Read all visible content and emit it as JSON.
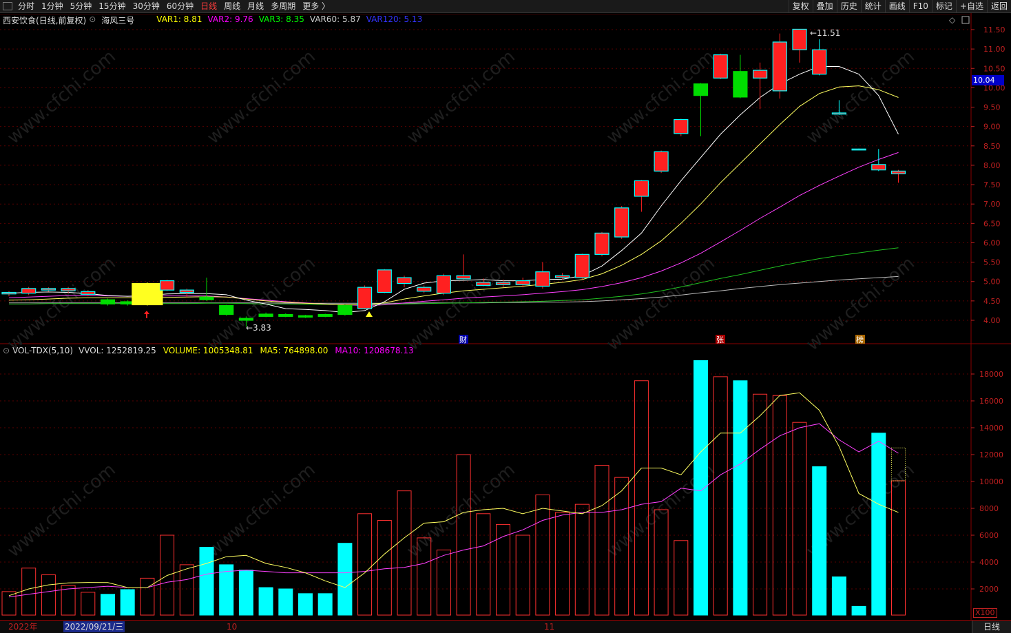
{
  "toolbar": {
    "left_items": [
      {
        "label": "分时",
        "active": false
      },
      {
        "label": "1分钟",
        "active": false
      },
      {
        "label": "5分钟",
        "active": false
      },
      {
        "label": "15分钟",
        "active": false
      },
      {
        "label": "30分钟",
        "active": false
      },
      {
        "label": "60分钟",
        "active": false
      },
      {
        "label": "日线",
        "active": true
      },
      {
        "label": "周线",
        "active": false
      },
      {
        "label": "月线",
        "active": false
      },
      {
        "label": "多周期",
        "active": false
      },
      {
        "label": "更多 〉",
        "active": false
      }
    ],
    "right_items": [
      "复权",
      "叠加",
      "历史",
      "统计",
      "画线",
      "F10",
      "标记",
      "+自选",
      "返回"
    ]
  },
  "price_panel": {
    "stock_name": "西安饮食",
    "mode": "(日线,前复权)",
    "formula": "海风三号",
    "indicators": [
      {
        "text": "VAR1: 8.81",
        "color": "#ffff00"
      },
      {
        "text": "VAR2: 9.76",
        "color": "#ff00ff"
      },
      {
        "text": "VAR3: 8.35",
        "color": "#00ff00"
      },
      {
        "text": "VAR60: 5.87",
        "color": "#cccccc"
      },
      {
        "text": "VAR120: 5.13",
        "color": "#3333ff"
      }
    ],
    "y_ticks": [
      "11.50",
      "11.00",
      "10.50",
      "10.00",
      "9.50",
      "9.00",
      "8.50",
      "8.00",
      "7.50",
      "7.00",
      "6.50",
      "6.00",
      "5.50",
      "5.00",
      "4.50",
      "4.00"
    ],
    "current_price": "10.04",
    "high_label": "11.51",
    "low_label": "3.83",
    "event_markers": [
      "财",
      "张",
      "榜"
    ]
  },
  "volume_panel": {
    "title": "VOL-TDX(5,10)",
    "indicators": [
      {
        "text": "VVOL: 1252819.25",
        "color": "#dddddd"
      },
      {
        "text": "VOLUME: 1005348.81",
        "color": "#ffff00"
      },
      {
        "text": "MA5: 764898.00",
        "color": "#ffff00"
      },
      {
        "text": "MA10: 1208678.13",
        "color": "#ff00ff"
      }
    ],
    "y_ticks": [
      "18000",
      "16000",
      "14000",
      "12000",
      "10000",
      "8000",
      "6000",
      "4000",
      "2000"
    ],
    "unit": "X100"
  },
  "date_axis": {
    "labels": [
      "2022年",
      "2022/09/21/三",
      "10",
      "11"
    ],
    "period": "日线"
  },
  "colors": {
    "up": "#ff2020",
    "down": "#00ffff",
    "down_price": "#00dd00",
    "ma_white": "#ffffff",
    "ma_yellow": "#ffff60",
    "ma_magenta": "#ff40ff",
    "ma_green": "#20c020",
    "ma_gray": "#bbbbbb"
  },
  "chart_data": {
    "type": "candlestick",
    "candles": [
      {
        "o": 4.68,
        "c": 4.72,
        "h": 4.75,
        "l": 4.62
      },
      {
        "o": 4.7,
        "c": 4.82,
        "h": 4.86,
        "l": 4.65
      },
      {
        "o": 4.78,
        "c": 4.82,
        "h": 4.85,
        "l": 4.74
      },
      {
        "o": 4.76,
        "c": 4.82,
        "h": 4.86,
        "l": 4.7
      },
      {
        "o": 4.67,
        "c": 4.74,
        "h": 4.78,
        "l": 4.62
      },
      {
        "o": 4.53,
        "c": 4.42,
        "h": 4.56,
        "l": 4.38
      },
      {
        "o": 4.48,
        "c": 4.42,
        "h": 4.52,
        "l": 4.38
      },
      {
        "o": 4.4,
        "c": 4.95,
        "h": 4.98,
        "l": 4.38
      },
      {
        "o": 4.78,
        "c": 5.02,
        "h": 5.05,
        "l": 4.75
      },
      {
        "o": 4.72,
        "c": 4.78,
        "h": 4.82,
        "l": 4.6
      },
      {
        "o": 4.6,
        "c": 4.53,
        "h": 5.1,
        "l": 4.5
      },
      {
        "o": 4.38,
        "c": 4.15,
        "h": 4.4,
        "l": 4.12
      },
      {
        "o": 4.05,
        "c": 4.0,
        "h": 4.1,
        "l": 3.83
      },
      {
        "o": 4.16,
        "c": 4.1,
        "h": 4.2,
        "l": 4.08
      },
      {
        "o": 4.15,
        "c": 4.1,
        "h": 4.18,
        "l": 4.08
      },
      {
        "o": 4.12,
        "c": 4.08,
        "h": 4.14,
        "l": 4.06
      },
      {
        "o": 4.15,
        "c": 4.1,
        "h": 4.17,
        "l": 4.08
      },
      {
        "o": 4.38,
        "c": 4.15,
        "h": 4.4,
        "l": 4.12
      },
      {
        "o": 4.3,
        "c": 4.85,
        "h": 4.9,
        "l": 4.28
      },
      {
        "o": 4.72,
        "c": 5.3,
        "h": 5.32,
        "l": 4.7
      },
      {
        "o": 4.95,
        "c": 5.1,
        "h": 5.15,
        "l": 4.85
      },
      {
        "o": 4.75,
        "c": 4.85,
        "h": 4.9,
        "l": 4.7
      },
      {
        "o": 4.7,
        "c": 5.15,
        "h": 5.2,
        "l": 4.65
      },
      {
        "o": 5.07,
        "c": 5.15,
        "h": 5.7,
        "l": 5.05
      },
      {
        "o": 4.9,
        "c": 4.98,
        "h": 5.08,
        "l": 4.88
      },
      {
        "o": 4.92,
        "c": 4.98,
        "h": 5.05,
        "l": 4.85
      },
      {
        "o": 4.92,
        "c": 5.02,
        "h": 5.1,
        "l": 4.85
      },
      {
        "o": 4.88,
        "c": 5.25,
        "h": 5.5,
        "l": 4.82
      },
      {
        "o": 5.1,
        "c": 5.15,
        "h": 5.22,
        "l": 5.05
      },
      {
        "o": 5.1,
        "c": 5.7,
        "h": 5.72,
        "l": 5.05
      },
      {
        "o": 5.7,
        "c": 6.25,
        "h": 6.28,
        "l": 5.65
      },
      {
        "o": 6.15,
        "c": 6.9,
        "h": 6.95,
        "l": 6.1
      },
      {
        "o": 7.2,
        "c": 7.6,
        "h": 7.62,
        "l": 6.8
      },
      {
        "o": 7.85,
        "c": 8.35,
        "h": 8.38,
        "l": 7.8
      },
      {
        "o": 8.82,
        "c": 9.18,
        "h": 9.2,
        "l": 8.75
      },
      {
        "o": 10.1,
        "c": 9.8,
        "h": 10.12,
        "l": 8.75
      },
      {
        "o": 10.25,
        "c": 10.85,
        "h": 10.88,
        "l": 10.22
      },
      {
        "o": 10.42,
        "c": 9.76,
        "h": 10.85,
        "l": 9.73
      },
      {
        "o": 10.25,
        "c": 10.45,
        "h": 10.65,
        "l": 9.45
      },
      {
        "o": 9.92,
        "c": 11.18,
        "h": 11.4,
        "l": 9.72
      },
      {
        "o": 10.98,
        "c": 11.51,
        "h": 11.51,
        "l": 10.65
      },
      {
        "o": 10.98,
        "c": 10.35,
        "h": 11.25,
        "l": 10.32
      },
      {
        "o": 9.35,
        "c": 9.32,
        "h": 9.68,
        "l": 9.3
      },
      {
        "o": 8.42,
        "c": 8.41,
        "h": 8.43,
        "l": 8.4
      },
      {
        "o": 8.02,
        "c": 7.88,
        "h": 8.42,
        "l": 7.85
      },
      {
        "o": 7.78,
        "c": 7.85,
        "h": 7.88,
        "l": 7.55
      }
    ],
    "ma_white": [
      4.7,
      4.72,
      4.73,
      4.72,
      4.69,
      4.64,
      4.62,
      4.64,
      4.68,
      4.69,
      4.69,
      4.66,
      4.52,
      4.42,
      4.3,
      4.28,
      4.25,
      4.2,
      4.25,
      4.48,
      4.8,
      4.96,
      5.02,
      5.03,
      5.05,
      5.02,
      5.02,
      5.05,
      5.06,
      5.15,
      5.4,
      5.8,
      6.25,
      6.95,
      7.6,
      8.2,
      8.8,
      9.3,
      9.75,
      10.1,
      10.35,
      10.55,
      10.55,
      10.35,
      9.8,
      8.8
    ],
    "ma_yellow": [
      4.52,
      4.53,
      4.55,
      4.57,
      4.58,
      4.58,
      4.58,
      4.58,
      4.59,
      4.6,
      4.61,
      4.6,
      4.55,
      4.5,
      4.46,
      4.44,
      4.42,
      4.4,
      4.4,
      4.45,
      4.55,
      4.63,
      4.7,
      4.76,
      4.8,
      4.84,
      4.88,
      4.93,
      4.98,
      5.05,
      5.2,
      5.42,
      5.7,
      6.05,
      6.5,
      7.0,
      7.55,
      8.05,
      8.55,
      9.05,
      9.52,
      9.85,
      10.02,
      10.05,
      9.95,
      9.75
    ],
    "ma_magenta": [
      4.58,
      4.6,
      4.62,
      4.64,
      4.64,
      4.63,
      4.62,
      4.62,
      4.63,
      4.63,
      4.63,
      4.6,
      4.56,
      4.52,
      4.48,
      4.45,
      4.42,
      4.4,
      4.38,
      4.4,
      4.45,
      4.49,
      4.53,
      4.57,
      4.6,
      4.63,
      4.66,
      4.7,
      4.74,
      4.79,
      4.87,
      4.97,
      5.1,
      5.27,
      5.48,
      5.73,
      6.02,
      6.32,
      6.63,
      6.92,
      7.22,
      7.48,
      7.72,
      7.95,
      8.15,
      8.33
    ],
    "ma_green": [
      4.42,
      4.42,
      4.43,
      4.43,
      4.43,
      4.43,
      4.43,
      4.43,
      4.43,
      4.43,
      4.44,
      4.44,
      4.43,
      4.42,
      4.42,
      4.41,
      4.41,
      4.4,
      4.4,
      4.41,
      4.42,
      4.43,
      4.44,
      4.45,
      4.46,
      4.47,
      4.48,
      4.49,
      4.51,
      4.53,
      4.57,
      4.62,
      4.68,
      4.76,
      4.86,
      4.97,
      5.08,
      5.18,
      5.29,
      5.4,
      5.5,
      5.59,
      5.67,
      5.74,
      5.81,
      5.87
    ],
    "ma_gray": [
      4.45,
      4.45,
      4.45,
      4.45,
      4.45,
      4.45,
      4.45,
      4.45,
      4.45,
      4.45,
      4.45,
      4.45,
      4.45,
      4.45,
      4.44,
      4.44,
      4.44,
      4.44,
      4.44,
      4.44,
      4.44,
      4.45,
      4.45,
      4.45,
      4.45,
      4.46,
      4.46,
      4.47,
      4.47,
      4.48,
      4.5,
      4.53,
      4.56,
      4.6,
      4.65,
      4.71,
      4.76,
      4.82,
      4.87,
      4.92,
      4.96,
      5.0,
      5.04,
      5.07,
      5.1,
      5.13
    ],
    "volume": [
      1800,
      3550,
      3050,
      2250,
      1750,
      1600,
      1950,
      2800,
      6000,
      3800,
      5100,
      3800,
      3400,
      2100,
      2000,
      1650,
      1650,
      5400,
      7600,
      7100,
      9300,
      5800,
      4900,
      12000,
      7600,
      6800,
      6000,
      9000,
      7700,
      8300,
      11200,
      10300,
      17500,
      7900,
      5600,
      19000,
      17800,
      17500,
      16500,
      16400,
      14400,
      11100,
      2900,
      700,
      13600,
      10050
    ],
    "vol_ma5": [
      1500,
      2000,
      2300,
      2450,
      2480,
      2470,
      2100,
      2100,
      3000,
      3500,
      3900,
      4400,
      4500,
      3900,
      3600,
      3200,
      2600,
      2100,
      3200,
      4600,
      5800,
      6900,
      7000,
      7700,
      7900,
      8000,
      7600,
      8000,
      7800,
      7600,
      8200,
      9300,
      11000,
      11000,
      10500,
      12200,
      13600,
      13600,
      14900,
      16400,
      16600,
      15300,
      12600,
      9100,
      8300,
      7700
    ],
    "vol_ma10": [
      1400,
      1600,
      1800,
      2000,
      2100,
      2200,
      2100,
      2100,
      2500,
      2700,
      3100,
      3300,
      3400,
      3300,
      3200,
      3200,
      3200,
      3200,
      3300,
      3500,
      3600,
      3900,
      4500,
      4900,
      5200,
      5900,
      6400,
      7100,
      7500,
      7700,
      7700,
      7900,
      8300,
      8500,
      9500,
      9300,
      10500,
      11300,
      12400,
      13400,
      14000,
      14300,
      13100,
      12200,
      13000,
      12100
    ]
  }
}
